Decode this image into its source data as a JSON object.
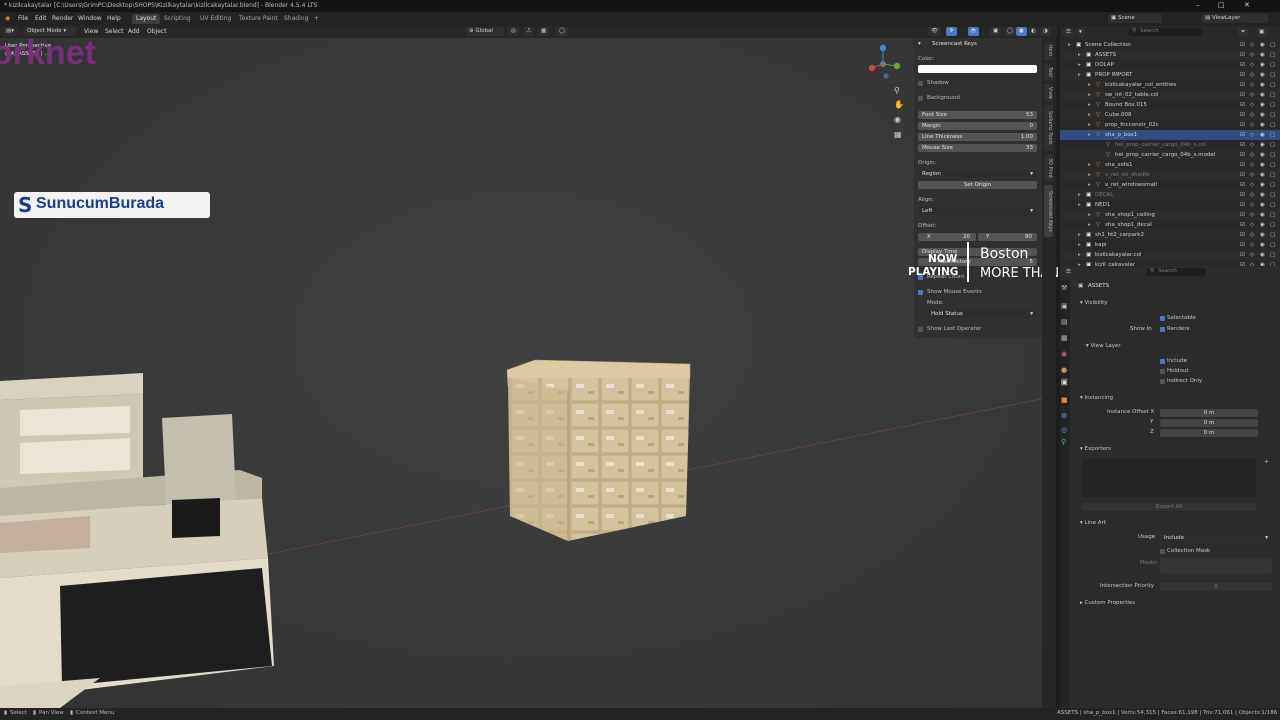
{
  "window": {
    "title": "* kizilcakaytalar [C:\\Users\\GrimPC\\Desktop\\SHOPS\\Kizilkaytalar\\kizilcakaytalar.blend] - Blender 4.5.4 LTS"
  },
  "menu": {
    "items": [
      "File",
      "Edit",
      "Render",
      "Window",
      "Help"
    ],
    "workspaces": [
      "Layout",
      "Scripting",
      "UV Editing",
      "Texture Paint",
      "Shading"
    ],
    "add_workspace": "+",
    "scene": "Scene",
    "view_layer": "ViewLayer"
  },
  "viewport_header": {
    "mode": "Object Mode",
    "menus": [
      "View",
      "Select",
      "Add",
      "Object"
    ],
    "orientation": "Global"
  },
  "viewport": {
    "perspective_label": "User Perspective",
    "collection_label": "(14) ASSETS | ...",
    "watermark": "orknet"
  },
  "screencast_panel": {
    "title": "Screencast Keys",
    "color_label": "Color:",
    "shadow_label": "Shadow",
    "background_label": "Background",
    "fields": [
      {
        "label": "Font Size",
        "value": "53"
      },
      {
        "label": "Margin",
        "value": "0"
      },
      {
        "label": "Line Thickness",
        "value": "1.00"
      },
      {
        "label": "Mouse Size",
        "value": "33"
      }
    ],
    "origin_label": "Origin:",
    "origin_value": "Region",
    "set_origin_label": "Set Origin",
    "align_label": "Align:",
    "align_value": "Left",
    "offset_label": "Offset:",
    "offset_x_label": "X",
    "offset_x": "20",
    "offset_y_label": "Y",
    "offset_y": "80",
    "display_time_label": "Display Time",
    "history_label": "Max History",
    "history_value": "5",
    "repeat_count_label": "Repeat Count",
    "show_mouse_label": "Show Mouse Events",
    "mode_label": "Mode:",
    "mode_value": "Hold Status",
    "show_last_label": "Show Last Operator"
  },
  "side_tabs": [
    "Item",
    "Tool",
    "View",
    "Sollumz Tools",
    "3D Print",
    "Screencast Keys"
  ],
  "outliner": {
    "search_placeholder": "Search",
    "rows": [
      {
        "name": "Scene Collection",
        "indent": 0,
        "style": "normal"
      },
      {
        "name": "ASSETS",
        "indent": 1,
        "style": "normal"
      },
      {
        "name": "DOLAP",
        "indent": 1,
        "style": "normal"
      },
      {
        "name": "PROP IMPORT",
        "indent": 1,
        "style": "normal"
      },
      {
        "name": "kizilcakayalar_col_entities",
        "indent": 2,
        "style": "normal"
      },
      {
        "name": "sw_int_02_table.col",
        "indent": 2,
        "style": "normal"
      },
      {
        "name": "Bound Box.015",
        "indent": 2,
        "style": "normal"
      },
      {
        "name": "Cube.008",
        "indent": 2,
        "style": "normal"
      },
      {
        "name": "prop_fncconstr_02c",
        "indent": 2,
        "style": "normal"
      },
      {
        "name": "sha_p_box1",
        "indent": 2,
        "style": "selected"
      },
      {
        "name": "hei_prop_carrier_cargo_04b_s.col",
        "indent": 3,
        "style": "dim"
      },
      {
        "name": "hei_prop_carrier_cargo_04b_s.model",
        "indent": 3,
        "style": "normal"
      },
      {
        "name": "sha_sofa1",
        "indent": 2,
        "style": "normal"
      },
      {
        "name": "v_ret_ml_shadfe",
        "indent": 2,
        "style": "dim"
      },
      {
        "name": "v_ret_windowsmall",
        "indent": 2,
        "style": "normal"
      },
      {
        "name": "DECAL",
        "indent": 1,
        "style": "dim"
      },
      {
        "name": "NED1",
        "indent": 1,
        "style": "normal"
      },
      {
        "name": "sha_shop1_ceiling",
        "indent": 2,
        "style": "normal"
      },
      {
        "name": "sha_shop1_decal",
        "indent": 2,
        "style": "normal"
      },
      {
        "name": "sh1_ht2_carpark2",
        "indent": 1,
        "style": "normal"
      },
      {
        "name": "kapi",
        "indent": 1,
        "style": "normal"
      },
      {
        "name": "kizilcakayalar.col",
        "indent": 1,
        "style": "normal"
      },
      {
        "name": "kizil_cakayalar",
        "indent": 1,
        "style": "normal"
      }
    ]
  },
  "properties": {
    "collection_name": "ASSETS",
    "visibility": "Visibility",
    "selectable": "Selectable",
    "show_in": "Show In",
    "renders": "Renders",
    "view_layer": "View Layer",
    "include": "Include",
    "holdout": "Holdout",
    "indirect_only": "Indirect Only",
    "instancing": "Instancing",
    "instance_offset_x": "Instance Offset X",
    "y_label": "Y",
    "z_label": "Z",
    "offset_x": "0 m",
    "offset_y": "0 m",
    "offset_z": "0 m",
    "exporters": "Exporters",
    "export_all": "Export All",
    "line_art": "Line Art",
    "usage_label": "Usage",
    "usage_value": "Include",
    "collection_mask": "Collection Mask",
    "masks": "Masks",
    "intersection_priority": "Intersection Priority",
    "intersection_priority_value": "0",
    "custom_properties": "Custom Properties",
    "search_placeholder": "Search"
  },
  "overlay": {
    "logo_text": "SunucumBurada",
    "now_playing": [
      "NOW",
      "PLAYING"
    ],
    "artist": "Boston",
    "song": "MORE THAN A FEELING"
  },
  "statusbar": {
    "left": [
      "Select",
      "Pan View",
      "Context Menu"
    ],
    "right": "ASSETS | sha_p_box1 | Verts:54,315 | Faces:61,198 | Tris:71,061 | Objects:1/186"
  },
  "colors": {
    "accent": "#4b79c8",
    "selection": "#334d80",
    "grid_x": "#9e4b4b",
    "grid_y": "#6a8a3a"
  }
}
